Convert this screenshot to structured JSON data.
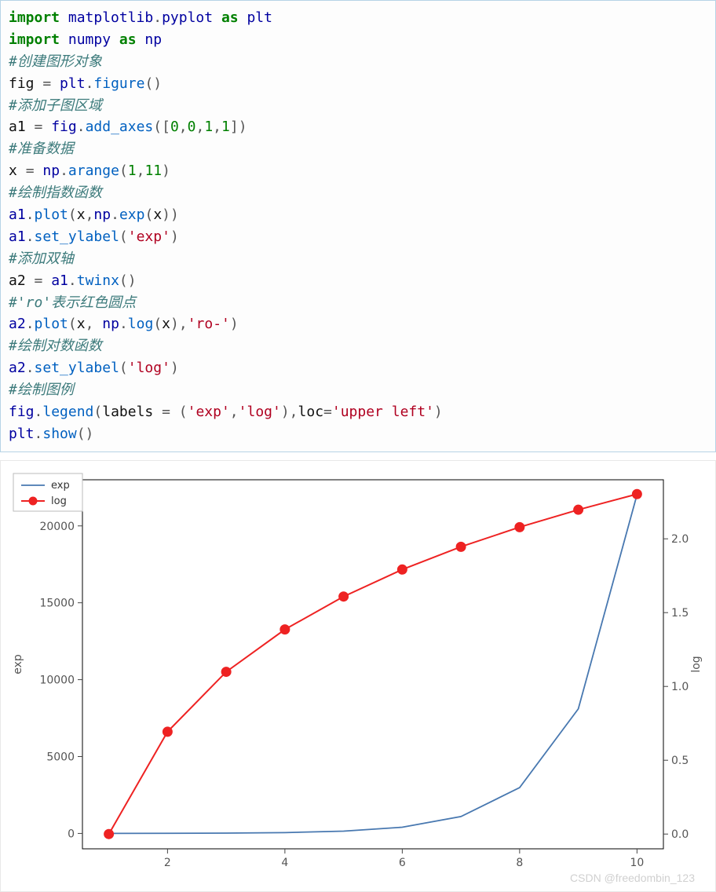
{
  "code": {
    "lines": [
      {
        "t": "kw",
        "s": "import "
      },
      {
        "t": "mod",
        "s": "matplotlib"
      },
      {
        "t": "op",
        "s": "."
      },
      {
        "t": "mod",
        "s": "pyplot"
      },
      {
        "t": "kw",
        "s": " as "
      },
      {
        "t": "mod",
        "s": "plt"
      },
      {
        "t": "nl"
      },
      {
        "t": "kw",
        "s": "import "
      },
      {
        "t": "mod",
        "s": "numpy"
      },
      {
        "t": "kw",
        "s": " as "
      },
      {
        "t": "mod",
        "s": "np"
      },
      {
        "t": "nl"
      },
      {
        "t": "com",
        "s": "#创建图形对象"
      },
      {
        "t": "nl"
      },
      {
        "t": "plain",
        "s": "fig "
      },
      {
        "t": "op",
        "s": "= "
      },
      {
        "t": "mod",
        "s": "plt"
      },
      {
        "t": "op",
        "s": "."
      },
      {
        "t": "func",
        "s": "figure"
      },
      {
        "t": "op",
        "s": "()"
      },
      {
        "t": "nl"
      },
      {
        "t": "com",
        "s": "#添加子图区域"
      },
      {
        "t": "nl"
      },
      {
        "t": "plain",
        "s": "a1 "
      },
      {
        "t": "op",
        "s": "= "
      },
      {
        "t": "mod",
        "s": "fig"
      },
      {
        "t": "op",
        "s": "."
      },
      {
        "t": "func",
        "s": "add_axes"
      },
      {
        "t": "op",
        "s": "(["
      },
      {
        "t": "num",
        "s": "0"
      },
      {
        "t": "op",
        "s": ","
      },
      {
        "t": "num",
        "s": "0"
      },
      {
        "t": "op",
        "s": ","
      },
      {
        "t": "num",
        "s": "1"
      },
      {
        "t": "op",
        "s": ","
      },
      {
        "t": "num",
        "s": "1"
      },
      {
        "t": "op",
        "s": "])"
      },
      {
        "t": "nl"
      },
      {
        "t": "com",
        "s": "#准备数据"
      },
      {
        "t": "nl"
      },
      {
        "t": "plain",
        "s": "x "
      },
      {
        "t": "op",
        "s": "= "
      },
      {
        "t": "mod",
        "s": "np"
      },
      {
        "t": "op",
        "s": "."
      },
      {
        "t": "func",
        "s": "arange"
      },
      {
        "t": "op",
        "s": "("
      },
      {
        "t": "num",
        "s": "1"
      },
      {
        "t": "op",
        "s": ","
      },
      {
        "t": "num",
        "s": "11"
      },
      {
        "t": "op",
        "s": ")"
      },
      {
        "t": "nl"
      },
      {
        "t": "com",
        "s": "#绘制指数函数"
      },
      {
        "t": "nl"
      },
      {
        "t": "mod",
        "s": "a1"
      },
      {
        "t": "op",
        "s": "."
      },
      {
        "t": "func",
        "s": "plot"
      },
      {
        "t": "op",
        "s": "("
      },
      {
        "t": "plain",
        "s": "x"
      },
      {
        "t": "op",
        "s": ","
      },
      {
        "t": "mod",
        "s": "np"
      },
      {
        "t": "op",
        "s": "."
      },
      {
        "t": "func",
        "s": "exp"
      },
      {
        "t": "op",
        "s": "("
      },
      {
        "t": "plain",
        "s": "x"
      },
      {
        "t": "op",
        "s": "))"
      },
      {
        "t": "nl"
      },
      {
        "t": "mod",
        "s": "a1"
      },
      {
        "t": "op",
        "s": "."
      },
      {
        "t": "func",
        "s": "set_ylabel"
      },
      {
        "t": "op",
        "s": "("
      },
      {
        "t": "str",
        "s": "'exp'"
      },
      {
        "t": "op",
        "s": ")"
      },
      {
        "t": "nl"
      },
      {
        "t": "com",
        "s": "#添加双轴"
      },
      {
        "t": "nl"
      },
      {
        "t": "plain",
        "s": "a2 "
      },
      {
        "t": "op",
        "s": "= "
      },
      {
        "t": "mod",
        "s": "a1"
      },
      {
        "t": "op",
        "s": "."
      },
      {
        "t": "func",
        "s": "twinx"
      },
      {
        "t": "op",
        "s": "()"
      },
      {
        "t": "nl"
      },
      {
        "t": "com",
        "s": "#'ro'表示红色圆点"
      },
      {
        "t": "nl"
      },
      {
        "t": "mod",
        "s": "a2"
      },
      {
        "t": "op",
        "s": "."
      },
      {
        "t": "func",
        "s": "plot"
      },
      {
        "t": "op",
        "s": "("
      },
      {
        "t": "plain",
        "s": "x"
      },
      {
        "t": "op",
        "s": ", "
      },
      {
        "t": "mod",
        "s": "np"
      },
      {
        "t": "op",
        "s": "."
      },
      {
        "t": "func",
        "s": "log"
      },
      {
        "t": "op",
        "s": "("
      },
      {
        "t": "plain",
        "s": "x"
      },
      {
        "t": "op",
        "s": "),"
      },
      {
        "t": "str",
        "s": "'ro-'"
      },
      {
        "t": "op",
        "s": ")"
      },
      {
        "t": "nl"
      },
      {
        "t": "com",
        "s": "#绘制对数函数"
      },
      {
        "t": "nl"
      },
      {
        "t": "mod",
        "s": "a2"
      },
      {
        "t": "op",
        "s": "."
      },
      {
        "t": "func",
        "s": "set_ylabel"
      },
      {
        "t": "op",
        "s": "("
      },
      {
        "t": "str",
        "s": "'log'"
      },
      {
        "t": "op",
        "s": ")"
      },
      {
        "t": "nl"
      },
      {
        "t": "com",
        "s": "#绘制图例"
      },
      {
        "t": "nl"
      },
      {
        "t": "mod",
        "s": "fig"
      },
      {
        "t": "op",
        "s": "."
      },
      {
        "t": "func",
        "s": "legend"
      },
      {
        "t": "op",
        "s": "("
      },
      {
        "t": "plain",
        "s": "labels "
      },
      {
        "t": "op",
        "s": "= ("
      },
      {
        "t": "str",
        "s": "'exp'"
      },
      {
        "t": "op",
        "s": ","
      },
      {
        "t": "str",
        "s": "'log'"
      },
      {
        "t": "op",
        "s": "),"
      },
      {
        "t": "plain",
        "s": "loc"
      },
      {
        "t": "op",
        "s": "="
      },
      {
        "t": "str",
        "s": "'upper left'"
      },
      {
        "t": "op",
        "s": ")"
      },
      {
        "t": "nl"
      },
      {
        "t": "mod",
        "s": "plt"
      },
      {
        "t": "op",
        "s": "."
      },
      {
        "t": "func",
        "s": "show"
      },
      {
        "t": "op",
        "s": "()"
      }
    ]
  },
  "legend": {
    "exp": "exp",
    "log": "log"
  },
  "ylabel_left": "exp",
  "ylabel_right": "log",
  "watermark": "CSDN @freedombin_123",
  "chart_data": {
    "type": "line",
    "x": [
      1,
      2,
      3,
      4,
      5,
      6,
      7,
      8,
      9,
      10
    ],
    "series": [
      {
        "name": "exp",
        "axis": "left",
        "values": [
          2.718,
          7.389,
          20.086,
          54.598,
          148.413,
          403.429,
          1096.633,
          2980.958,
          8103.084,
          22026.466
        ],
        "style": "blue-line"
      },
      {
        "name": "log",
        "axis": "right",
        "values": [
          0.0,
          0.693,
          1.099,
          1.386,
          1.609,
          1.792,
          1.946,
          2.079,
          2.197,
          2.303
        ],
        "style": "red-dot-line"
      }
    ],
    "left_axis": {
      "label": "exp",
      "ticks": [
        0,
        5000,
        10000,
        15000,
        20000
      ],
      "lim": [
        -1000,
        23000
      ]
    },
    "right_axis": {
      "label": "log",
      "ticks": [
        0.0,
        0.5,
        1.0,
        1.5,
        2.0
      ],
      "lim": [
        -0.1,
        2.4
      ]
    },
    "x_axis": {
      "ticks": [
        2,
        4,
        6,
        8,
        10
      ],
      "lim": [
        0.55,
        10.45
      ]
    }
  }
}
